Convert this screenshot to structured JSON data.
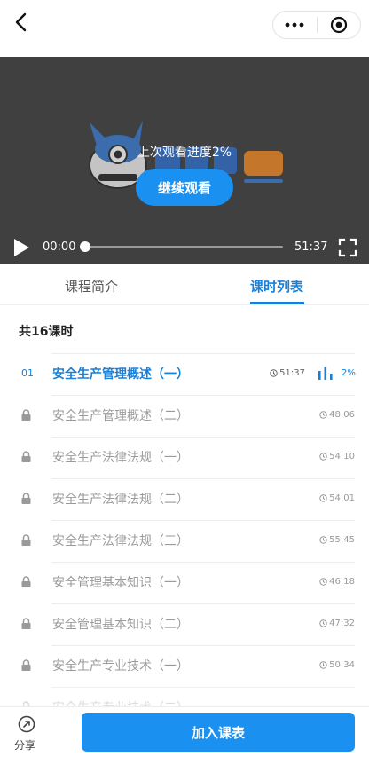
{
  "colors": {
    "accent": "#1a90f0",
    "tab_active": "#1a7fd6",
    "video_bg": "#404040",
    "locked_text": "#9a9a9a"
  },
  "nav": {
    "back_icon": "chevron-left-icon",
    "more_icon": "more-dots-icon",
    "close_icon": "target-circle-icon"
  },
  "video": {
    "resume_tip": "上次观看进度2%",
    "continue_label": "继续观看",
    "current_time": "00:00",
    "total_time": "51:37",
    "progress": 0
  },
  "tabs": [
    {
      "label": "课程简介",
      "active": false
    },
    {
      "label": "课时列表",
      "active": true
    }
  ],
  "list": {
    "count_label": "共16课时",
    "lessons": [
      {
        "index": "01",
        "title": "安全生产管理概述（一）",
        "duration": "51:37",
        "progress": "2%",
        "locked": false,
        "current": true
      },
      {
        "title": "安全生产管理概述（二）",
        "duration": "48:06",
        "locked": true
      },
      {
        "title": "安全生产法律法规（一）",
        "duration": "54:10",
        "locked": true
      },
      {
        "title": "安全生产法律法规（二）",
        "duration": "54:01",
        "locked": true
      },
      {
        "title": "安全生产法律法规（三）",
        "duration": "55:45",
        "locked": true
      },
      {
        "title": "安全管理基本知识（一）",
        "duration": "46:18",
        "locked": true
      },
      {
        "title": "安全管理基本知识（二）",
        "duration": "47:32",
        "locked": true
      },
      {
        "title": "安全生产专业技术（一）",
        "duration": "50:34",
        "locked": true
      },
      {
        "title": "安全生产专业技术（二）",
        "duration": "",
        "locked": true
      }
    ]
  },
  "bottom": {
    "share_label": "分享",
    "join_label": "加入课表"
  }
}
